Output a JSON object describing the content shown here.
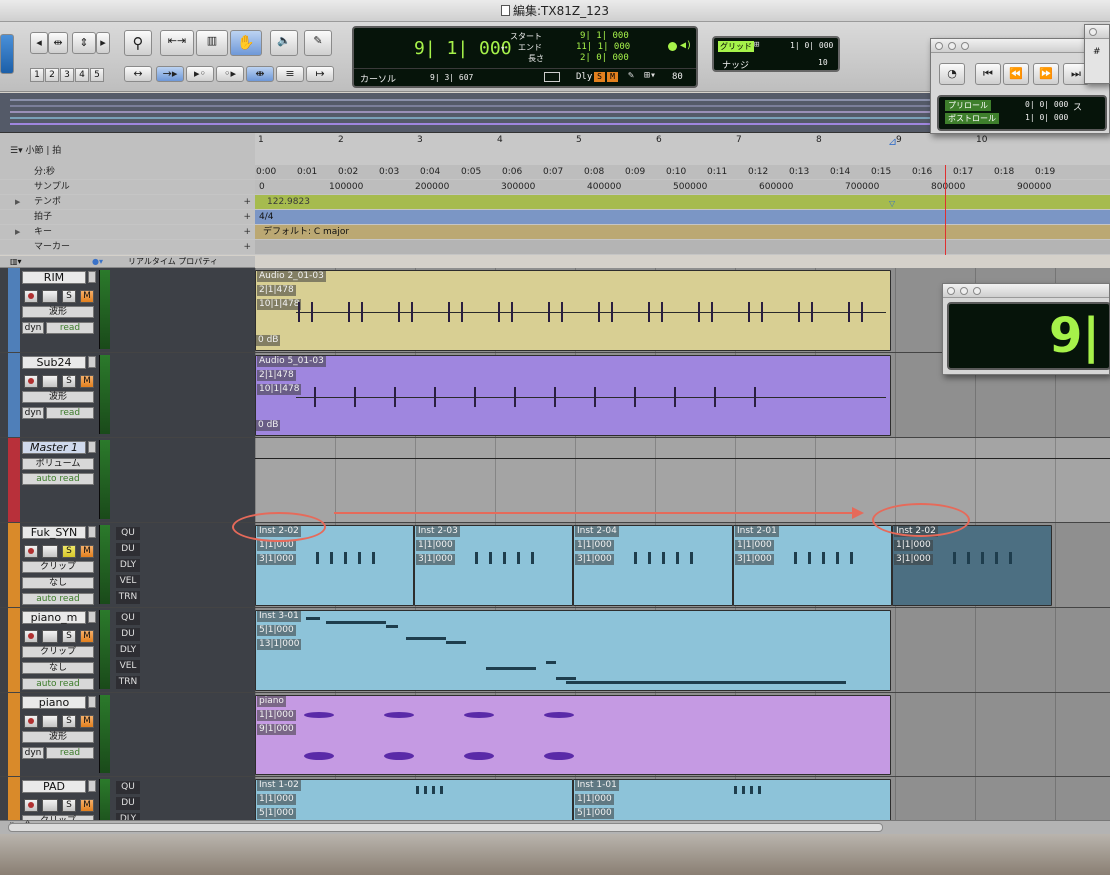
{
  "window": {
    "title": "編集:TX81Z_123"
  },
  "toolbar": {
    "nums": [
      "1",
      "2",
      "3",
      "4",
      "5"
    ],
    "counter": {
      "main": "9| 1| 000",
      "start_label": "スタート",
      "end_label": "エンド",
      "length_label": "長さ",
      "start": "9| 1| 000",
      "end": "11| 1| 000",
      "length": "2| 0| 000",
      "cursor_label": "カーソル",
      "cursor": "9| 3| 607",
      "dly": "Dly",
      "tempo": "80"
    },
    "grid": {
      "grid_label": "グリッド",
      "grid_value": "1| 0| 000",
      "nudge_label": "ナッジ",
      "nudge_value": "10"
    }
  },
  "rulers": {
    "timebase_label": "小節 | 拍",
    "bars": [
      "1",
      "2",
      "3",
      "4",
      "5",
      "6",
      "7",
      "8",
      "9",
      "10"
    ],
    "rows": [
      {
        "label": "分:秒",
        "ticks": [
          "0:00",
          "0:01",
          "0:02",
          "0:03",
          "0:04",
          "0:05",
          "0:06",
          "0:07",
          "0:08",
          "0:09",
          "0:10",
          "0:11",
          "0:12",
          "0:13",
          "0:14",
          "0:15",
          "0:16",
          "0:17",
          "0:18",
          "0:19"
        ]
      },
      {
        "label": "サンプル",
        "ticks": [
          "0",
          "100000",
          "200000",
          "300000",
          "400000",
          "500000",
          "600000",
          "700000",
          "800000",
          "900000"
        ]
      },
      {
        "label": "テンポ",
        "value": "122.9823"
      },
      {
        "label": "拍子",
        "value": "4/4"
      },
      {
        "label": "キー",
        "value": "デフォルト: C major"
      },
      {
        "label": "マーカー",
        "value": ""
      }
    ]
  },
  "edit_header": {
    "label": "リアルタイム プロパティ"
  },
  "tracks": [
    {
      "name": "RIM",
      "view": "波形",
      "auto": "read",
      "dyn": "dyn",
      "vol": "0 dB",
      "regions": [
        {
          "name": "Audio 2_01-03",
          "line1": "2|1|478",
          "line2": "10|1|478"
        }
      ]
    },
    {
      "name": "Sub24",
      "view": "波形",
      "auto": "read",
      "dyn": "dyn",
      "vol": "0 dB",
      "regions": [
        {
          "name": "Audio 5_01-03",
          "line1": "2|1|478",
          "line2": "10|1|478"
        }
      ]
    },
    {
      "name": "Master 1",
      "view": "ボリューム",
      "auto": "auto read"
    },
    {
      "name": "Fuk_SYN",
      "view": "クリップ",
      "none": "なし",
      "auto": "auto read",
      "rtp": [
        "QU",
        "DU",
        "DLY",
        "VEL",
        "TRN"
      ],
      "regions": [
        {
          "name": "Inst 2-02",
          "line1": "1|1|000",
          "line2": "3|1|000"
        },
        {
          "name": "Inst 2-03",
          "line1": "1|1|000",
          "line2": "3|1|000"
        },
        {
          "name": "Inst 2-04",
          "line1": "1|1|000",
          "line2": "3|1|000"
        },
        {
          "name": "Inst 2-01",
          "line1": "1|1|000",
          "line2": "3|1|000"
        },
        {
          "name": "Inst 2-02",
          "line1": "1|1|000",
          "line2": "3|1|000"
        }
      ]
    },
    {
      "name": "piano_m",
      "view": "クリップ",
      "none": "なし",
      "auto": "auto read",
      "rtp": [
        "QU",
        "DU",
        "DLY",
        "VEL",
        "TRN"
      ],
      "regions": [
        {
          "name": "Inst 3-01",
          "line1": "5|1|000",
          "line2": "13|1|000"
        }
      ]
    },
    {
      "name": "piano",
      "view": "波形",
      "auto": "read",
      "dyn": "dyn",
      "regions": [
        {
          "name": "piano",
          "line1": "1|1|000",
          "line2": "9|1|000"
        }
      ]
    },
    {
      "name": "PAD",
      "view": "クリップ",
      "rtp": [
        "QU",
        "DU",
        "DLY"
      ],
      "regions": [
        {
          "name": "Inst 1-02",
          "line1": "1|1|000",
          "line2": "5|1|000"
        },
        {
          "name": "Inst 1-01",
          "line1": "1|1|000",
          "line2": "5|1|000"
        }
      ]
    }
  ],
  "floating": {
    "transport": {
      "preroll_label": "プリロール",
      "preroll": "0| 0| 000",
      "postroll_label": "ポストロール",
      "postroll": "1| 0| 000",
      "extra": "ス"
    },
    "bigcounter": {
      "value": "9|"
    }
  },
  "colors": {
    "rim": "#d8cf93",
    "sub": "#9f86df",
    "syn": "#8dc3d9",
    "piano": "#c59ae3",
    "accent": "#a6f24a",
    "annotation": "#e66a5a"
  }
}
